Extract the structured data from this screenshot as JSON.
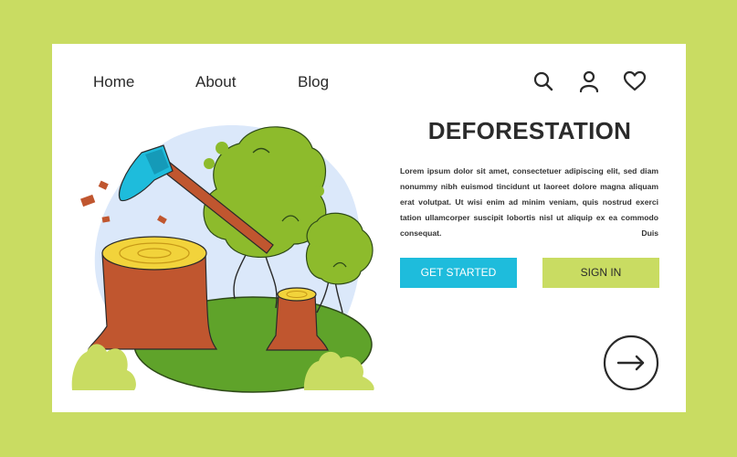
{
  "nav": {
    "home": "Home",
    "about": "About",
    "blog": "Blog"
  },
  "icons": [
    "search-icon",
    "user-icon",
    "heart-icon",
    "arrow-right-icon"
  ],
  "hero": {
    "title": "DEFORESTATION",
    "paragraph": "Lorem ipsum dolor sit amet, consectetuer adipiscing elit, sed diam nonummy nibh euismod tincidunt ut laoreet dolore magna aliquam erat volutpat. Ut wisi enim ad minim veniam, quis nostrud exerci tation ullamcorper suscipit lobortis nisl ut aliquip ex ea commodo consequat. Duis"
  },
  "buttons": {
    "get_started": "GET STARTED",
    "sign_in": "SIGN IN"
  },
  "colors": {
    "background": "#c9dc62",
    "card": "#ffffff",
    "primary_button": "#1ebcdc",
    "secondary_button": "#c9dc62",
    "stump": "#c0562f",
    "stump_top": "#f2d33b",
    "foliage": "#8dbb2c",
    "ground": "#5fa32a",
    "sky_blob": "#dbe8fa"
  }
}
